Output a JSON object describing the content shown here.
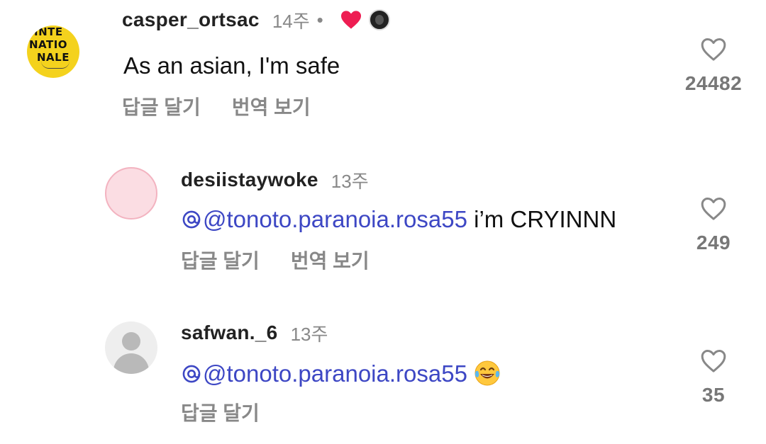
{
  "comments": [
    {
      "username": "casper_ortsac",
      "time": "14주",
      "separator": "•",
      "text": "As an asian, I'm safe",
      "actions": [
        "답글 달기",
        "번역 보기"
      ],
      "likes": "24482",
      "avatar_text": [
        "INTE",
        "NATIO",
        "NALE"
      ]
    },
    {
      "username": "desiistaywoke",
      "time": "13주",
      "mention": "@tonoto.paranoia.rosa55",
      "text": " i’m CRYINNN",
      "actions": [
        "답글 달기",
        "번역 보기"
      ],
      "likes": "249"
    },
    {
      "username": "safwan._6",
      "time": "13주",
      "mention": "@tonoto.paranoia.rosa55",
      "actions": [
        "답글 달기"
      ],
      "likes": "35"
    }
  ],
  "colors": {
    "liked_heart": "#ee1d52",
    "mention": "#3d47c4",
    "muted": "#888888"
  },
  "icons": {
    "like": "heart-outline-icon",
    "creator_liked": "heart-filled-icon",
    "mention": "mention-at-icon",
    "emoji": "laughing-tears-emoji"
  }
}
